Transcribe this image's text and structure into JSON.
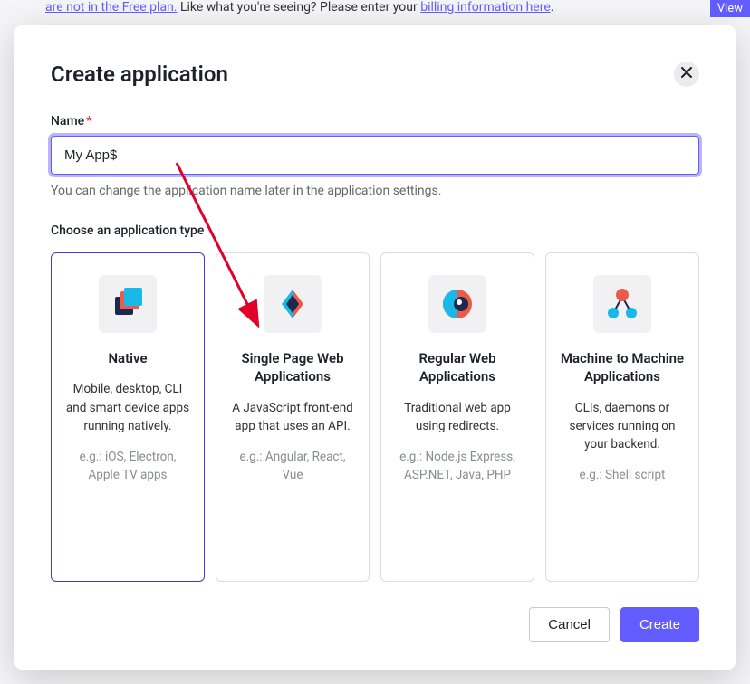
{
  "backdrop": {
    "link1": "are not in the Free plan.",
    "text_mid": " Like what you're seeing? Please enter your ",
    "link2": "billing information here",
    "dot": ".",
    "view_btn": "View"
  },
  "modal": {
    "title": "Create application",
    "name_label": "Name",
    "name_required": "*",
    "name_value": "My App$",
    "name_hint": "You can change the application name later in the application settings.",
    "type_section_label": "Choose an application type",
    "cancel_label": "Cancel",
    "create_label": "Create"
  },
  "types": [
    {
      "title": "Native",
      "desc": "Mobile, desktop, CLI and smart device apps running natively.",
      "example": "e.g.: iOS, Electron, Apple TV apps",
      "selected": true
    },
    {
      "title": "Single Page Web Applications",
      "desc": "A JavaScript front-end app that uses an API.",
      "example": "e.g.: Angular, React, Vue",
      "selected": false
    },
    {
      "title": "Regular Web Applications",
      "desc": "Traditional web app using redirects.",
      "example": "e.g.: Node.js Express, ASP.NET, Java, PHP",
      "selected": false
    },
    {
      "title": "Machine to Machine Applications",
      "desc": "CLIs, daemons or services running on your backend.",
      "example": "e.g.: Shell script",
      "selected": false
    }
  ]
}
